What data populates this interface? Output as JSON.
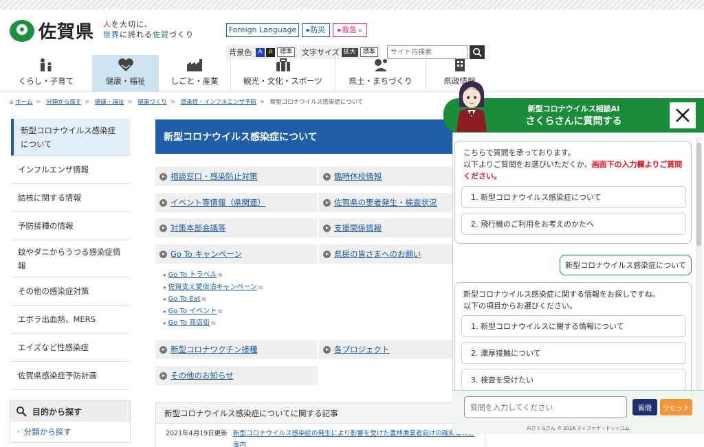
{
  "header": {
    "logo_text": "佐賀県",
    "tagline_1a": "人",
    "tagline_1b": "を大切に、",
    "tagline_2a": "世界",
    "tagline_2b": "に誇れる",
    "tagline_2c": "佐賀",
    "tagline_2d": "づくり",
    "foreign_language": "Foreign Language",
    "bousai": "防災",
    "kyukyu": "救急",
    "bg_color_label": "背景色",
    "bg_a1": "A",
    "bg_a2": "A",
    "bg_standard": "標準",
    "font_size_label": "文字サイズ",
    "font_enlarge": "拡大",
    "font_standard": "標準",
    "search_placeholder": "サイト内検索"
  },
  "nav": {
    "items": [
      {
        "label": "くらし・子育て"
      },
      {
        "label": "健康・福祉"
      },
      {
        "label": "しごと・産業"
      },
      {
        "label": "観光・文化・スポーツ"
      },
      {
        "label": "県土・まちづくり"
      },
      {
        "label": "県政情報"
      }
    ]
  },
  "breadcrumb": {
    "home": "ホーム",
    "c1": "分類から探す",
    "c2": "健康・福祉",
    "c3": "健康づくり",
    "c4": "感染症・インフルエンザ予防",
    "current": "新型コロナウイルス感染症について"
  },
  "sidebar": {
    "items": [
      {
        "label": "新型コロナウイルス感染症について"
      },
      {
        "label": "インフルエンザ情報"
      },
      {
        "label": "結核に関する情報"
      },
      {
        "label": "予防接種の情報"
      },
      {
        "label": "蚊やダニからうつる感染症情報"
      },
      {
        "label": "その他の感染症対策"
      },
      {
        "label": "エボラ出血熱、MERS"
      },
      {
        "label": "エイズなど性感染症"
      },
      {
        "label": "佐賀県感染症予防計画"
      }
    ],
    "purpose_title": "目的から探す",
    "purpose_item": "分類から探す"
  },
  "main": {
    "title": "新型コロナウイルス感染症について",
    "links": [
      {
        "label": "相談窓口・感染防止対策"
      },
      {
        "label": "臨時休校情報"
      },
      {
        "label": "イベント等情報（県関連）"
      },
      {
        "label": "佐賀県の患者発生・検査状況"
      },
      {
        "label": "対策本部会議等"
      },
      {
        "label": "支援関係情報"
      },
      {
        "label": "Go To キャンペーン"
      },
      {
        "label": "県民の皆さまへのお願い"
      },
      {
        "label": "新型コロナワクチン接種"
      },
      {
        "label": "各プロジェクト"
      },
      {
        "label": "その他のお知らせ"
      }
    ],
    "sub_links": [
      {
        "label": "Go To トラベル"
      },
      {
        "label": "佐賀支え愛宿泊キャンペーン"
      },
      {
        "label": "Go To Eat"
      },
      {
        "label": "Go To イベント"
      },
      {
        "label": "Go To 商店街"
      }
    ],
    "articles_title": "新型コロナウイルス感染症についてに関する記事",
    "article_date": "2021年4月19日更新",
    "article_title": "新型コロナウイルス感染症の発生により影響を受けた農林漁業者向けの融資等のご案内"
  },
  "chat": {
    "header_sub": "新型コロナウイルス相談AI",
    "header_main": "さくらさんに質問する",
    "msg1_line1": "こちらで質問を承っております。",
    "msg1_line2a": "以下よりご質問をお選びいただくか、",
    "msg1_line2b": "画面下の入力欄よりご質問ください。",
    "options1": [
      {
        "label": "1. 新型コロナウイルス感染症について"
      },
      {
        "label": "2. 飛行機のご利用をお考えのかたへ"
      }
    ],
    "user_msg": "新型コロナウイルス感染症について",
    "msg2_line1": "新型コロナウイルス感染症に関する情報をお探しですね。",
    "msg2_line2": "以下の項目からお選びください。",
    "options2": [
      {
        "label": "1. 新型コロナウイルスに関する情報について"
      },
      {
        "label": "2. 濃厚接触について"
      },
      {
        "label": "3. 検査を受けたい"
      }
    ],
    "input_placeholder": "質問を入力してください",
    "ask_button": "質問",
    "reset_button": "リセット",
    "copyright": "AIさくらさん © 2016 ティファナ・ドットコム"
  },
  "colors": {
    "brand_green": "#1a8c3a",
    "brand_blue": "#1f5ea8",
    "alert_red": "#e3161f",
    "reset_orange": "#f3963a",
    "ask_navy": "#1d2f6e"
  }
}
